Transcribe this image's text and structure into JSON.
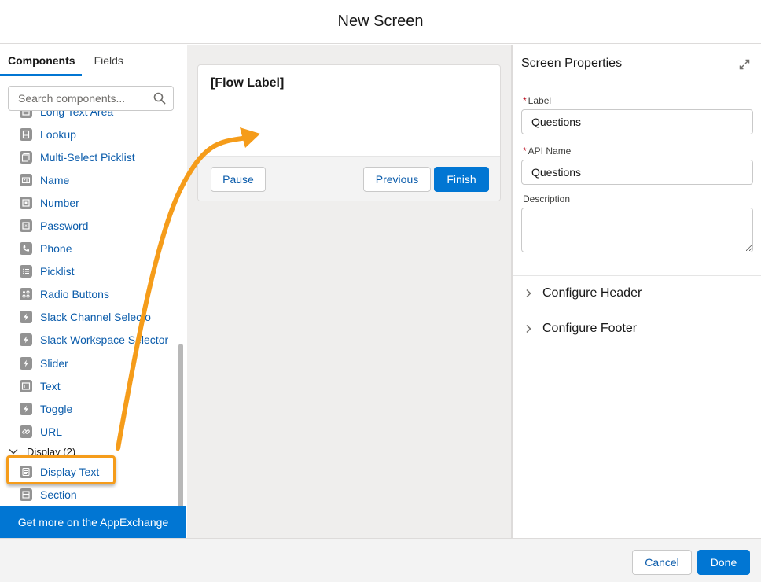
{
  "modal": {
    "title": "New Screen"
  },
  "left_panel": {
    "tabs": [
      {
        "label": "Components",
        "active": true
      },
      {
        "label": "Fields",
        "active": false
      }
    ],
    "search": {
      "placeholder": "Search components...",
      "value": ""
    },
    "items": [
      {
        "label": "Long Text Area",
        "icon": "textarea-icon"
      },
      {
        "label": "Lookup",
        "icon": "lookup-icon"
      },
      {
        "label": "Multi-Select Picklist",
        "icon": "multi-picklist-icon"
      },
      {
        "label": "Name",
        "icon": "name-card-icon"
      },
      {
        "label": "Number",
        "icon": "number-icon"
      },
      {
        "label": "Password",
        "icon": "password-icon"
      },
      {
        "label": "Phone",
        "icon": "phone-icon"
      },
      {
        "label": "Picklist",
        "icon": "picklist-icon"
      },
      {
        "label": "Radio Buttons",
        "icon": "radio-buttons-icon"
      },
      {
        "label": "Slack Channel Selecto",
        "icon": "lightning-icon"
      },
      {
        "label": "Slack Workspace Selector",
        "icon": "lightning-icon"
      },
      {
        "label": "Slider",
        "icon": "lightning-icon"
      },
      {
        "label": "Text",
        "icon": "text-input-icon"
      },
      {
        "label": "Toggle",
        "icon": "lightning-icon"
      },
      {
        "label": "URL",
        "icon": "link-icon"
      }
    ],
    "display_group": {
      "label": "Display (2)",
      "expanded": true,
      "items": [
        {
          "label": "Display Text",
          "icon": "display-text-icon",
          "highlighted": true
        },
        {
          "label": "Section",
          "icon": "section-icon"
        }
      ]
    },
    "appexchange_label": "Get more on the AppExchange"
  },
  "canvas": {
    "card_title": "[Flow Label]",
    "buttons": {
      "pause": "Pause",
      "previous": "Previous",
      "finish": "Finish"
    }
  },
  "right_panel": {
    "title": "Screen Properties",
    "fields": {
      "label": {
        "label": "Label",
        "required": true,
        "value": "Questions"
      },
      "api_name": {
        "label": "API Name",
        "required": true,
        "value": "Questions"
      },
      "description": {
        "label": "Description",
        "required": false,
        "value": ""
      }
    },
    "sections": [
      {
        "label": "Configure Header",
        "expanded": false
      },
      {
        "label": "Configure Footer",
        "expanded": false
      }
    ]
  },
  "footer": {
    "cancel": "Cancel",
    "done": "Done"
  },
  "colors": {
    "brand": "#0176d3",
    "link": "#0b5cab",
    "annotation": "#f59c1a",
    "required": "#ba0517"
  },
  "required_marker": "*"
}
